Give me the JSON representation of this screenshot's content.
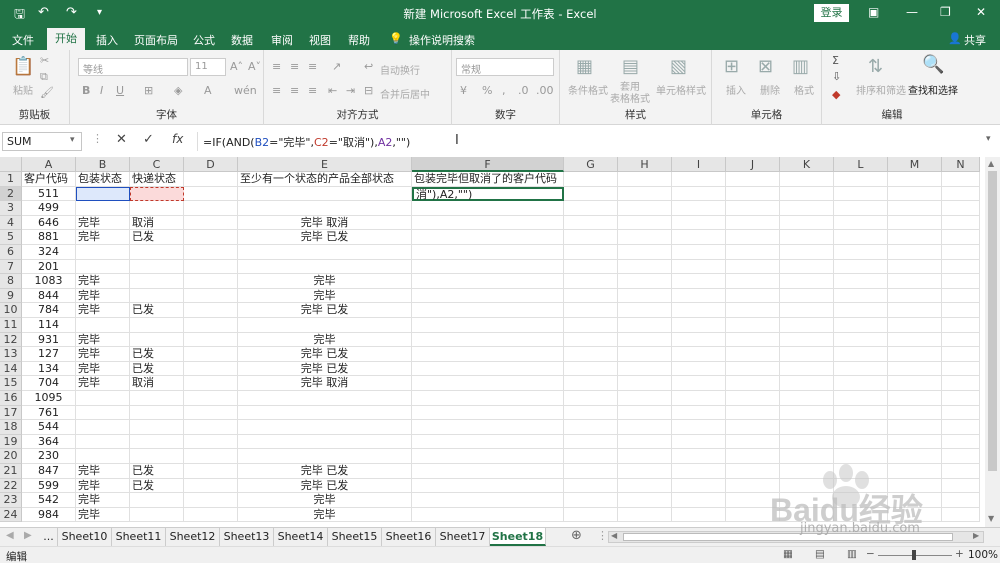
{
  "title": "新建 Microsoft Excel 工作表 - Excel",
  "login_label": "登录",
  "menu": [
    "文件",
    "开始",
    "插入",
    "页面布局",
    "公式",
    "数据",
    "审阅",
    "视图",
    "帮助"
  ],
  "tell_me": "操作说明搜索",
  "share": "共享",
  "ribbon": {
    "clipboard": {
      "label": "剪贴板",
      "paste": "粘贴"
    },
    "font": {
      "label": "字体",
      "name": "等线",
      "size": "11"
    },
    "alignment": {
      "label": "对齐方式",
      "wrap": "自动换行",
      "merge": "合并后居中"
    },
    "number": {
      "label": "数字",
      "format": "常规"
    },
    "styles": {
      "label": "样式",
      "cond": "条件格式",
      "table": "套用\n表格格式",
      "cell": "单元格样式"
    },
    "cells": {
      "label": "单元格",
      "insert": "插入",
      "delete": "删除",
      "format": "格式"
    },
    "editing": {
      "label": "编辑",
      "sort": "排序和筛选",
      "find": "查找和选择"
    }
  },
  "name_box": "SUM",
  "formula_parts": [
    "=IF(AND(",
    "B2",
    "=\"完毕\",",
    "C2",
    "=\"取消\"),",
    "A2",
    ",\"\")"
  ],
  "columns": [
    "A",
    "B",
    "C",
    "D",
    "E",
    "F",
    "G",
    "H",
    "I",
    "J",
    "K",
    "L",
    "M",
    "N"
  ],
  "rows": [
    {
      "n": "1",
      "A": "客户代码",
      "B": "包装状态",
      "C": "快递状态",
      "E": "至少有一个状态的产品全部状态",
      "F": "包装完毕但取消了的客户代码"
    },
    {
      "n": "2",
      "A": "511",
      "F": "消\"),A2,\"\")"
    },
    {
      "n": "3",
      "A": "499"
    },
    {
      "n": "4",
      "A": "646",
      "B": "完毕",
      "C": "取消",
      "E": "完毕 取消"
    },
    {
      "n": "5",
      "A": "881",
      "B": "完毕",
      "C": "已发",
      "E": "完毕 已发"
    },
    {
      "n": "6",
      "A": "324"
    },
    {
      "n": "7",
      "A": "201"
    },
    {
      "n": "8",
      "A": "1083",
      "B": "完毕",
      "E": "完毕"
    },
    {
      "n": "9",
      "A": "844",
      "B": "完毕",
      "E": "完毕"
    },
    {
      "n": "10",
      "A": "784",
      "B": "完毕",
      "C": "已发",
      "E": "完毕 已发"
    },
    {
      "n": "11",
      "A": "114"
    },
    {
      "n": "12",
      "A": "931",
      "B": "完毕",
      "E": "完毕"
    },
    {
      "n": "13",
      "A": "127",
      "B": "完毕",
      "C": "已发",
      "E": "完毕 已发"
    },
    {
      "n": "14",
      "A": "134",
      "B": "完毕",
      "C": "已发",
      "E": "完毕 已发"
    },
    {
      "n": "15",
      "A": "704",
      "B": "完毕",
      "C": "取消",
      "E": "完毕 取消"
    },
    {
      "n": "16",
      "A": "1095"
    },
    {
      "n": "17",
      "A": "761"
    },
    {
      "n": "18",
      "A": "544"
    },
    {
      "n": "19",
      "A": "364"
    },
    {
      "n": "20",
      "A": "230"
    },
    {
      "n": "21",
      "A": "847",
      "B": "完毕",
      "C": "已发",
      "E": "完毕 已发"
    },
    {
      "n": "22",
      "A": "599",
      "B": "完毕",
      "C": "已发",
      "E": "完毕 已发"
    },
    {
      "n": "23",
      "A": "542",
      "B": "完毕",
      "E": "完毕"
    },
    {
      "n": "24",
      "A": "984",
      "B": "完毕",
      "E": "完毕"
    }
  ],
  "sheets": [
    "...",
    "Sheet10",
    "Sheet11",
    "Sheet12",
    "Sheet13",
    "Sheet14",
    "Sheet15",
    "Sheet16",
    "Sheet17",
    "Sheet18"
  ],
  "active_sheet": "Sheet18",
  "status": "编辑",
  "zoom": "100%",
  "colors": {
    "excel_green": "#217346",
    "ref_blue": "#1f4fbf",
    "ref_red": "#c0392b"
  },
  "watermark": {
    "brand": "Baidu经验",
    "url": "jingyan.baidu.com"
  }
}
